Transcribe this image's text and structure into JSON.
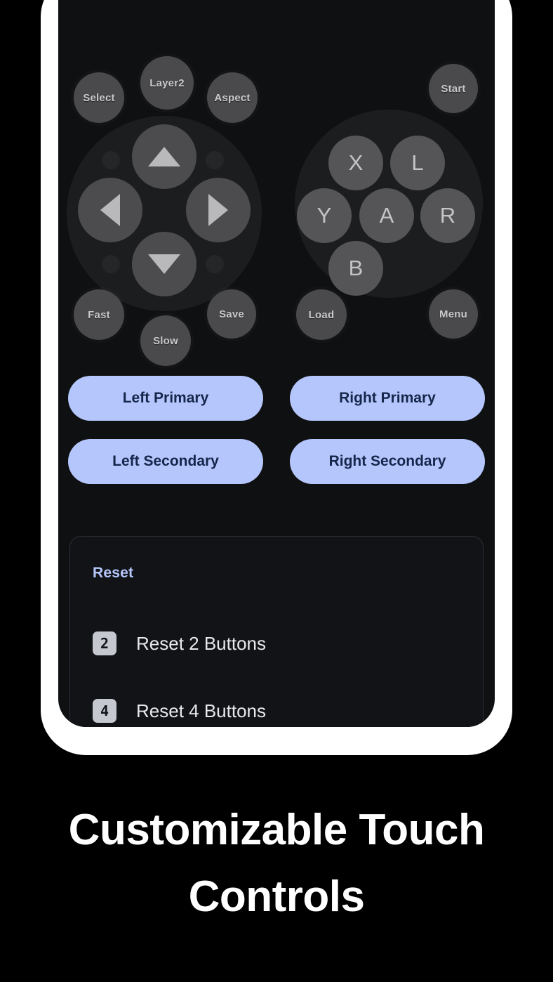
{
  "screen": {
    "background_color": "#0f1012",
    "frame_color": "#ffffff"
  },
  "touch_overlay": {
    "utility_buttons": [
      {
        "label": "Select"
      },
      {
        "label": "Layer2"
      },
      {
        "label": "Aspect"
      },
      {
        "label": "Start"
      }
    ],
    "dpad": {
      "up_icon": "triangle-up-icon",
      "down_icon": "triangle-down-icon",
      "left_icon": "triangle-left-icon",
      "right_icon": "triangle-right-icon"
    },
    "face_buttons": [
      {
        "label": "X"
      },
      {
        "label": "L"
      },
      {
        "label": "Y"
      },
      {
        "label": "A"
      },
      {
        "label": "R"
      },
      {
        "label": "B"
      }
    ],
    "bottom_buttons": [
      {
        "label": "Fast"
      },
      {
        "label": "Slow"
      },
      {
        "label": "Save"
      },
      {
        "label": "Load"
      },
      {
        "label": "Menu"
      }
    ]
  },
  "pills": {
    "accent_color": "#b4c6fb",
    "text_color": "#16264b",
    "rows": [
      [
        {
          "label": "Left Primary"
        },
        {
          "label": "Right Primary"
        }
      ],
      [
        {
          "label": "Left Secondary"
        },
        {
          "label": "Right Secondary"
        }
      ]
    ]
  },
  "reset_card": {
    "title": "Reset",
    "title_color": "#b4c6fb",
    "items": [
      {
        "badge": "2",
        "label": "Reset 2 Buttons"
      },
      {
        "badge": "4",
        "label": "Reset 4 Buttons"
      }
    ]
  },
  "caption": {
    "text": "Customizable Touch Controls"
  }
}
